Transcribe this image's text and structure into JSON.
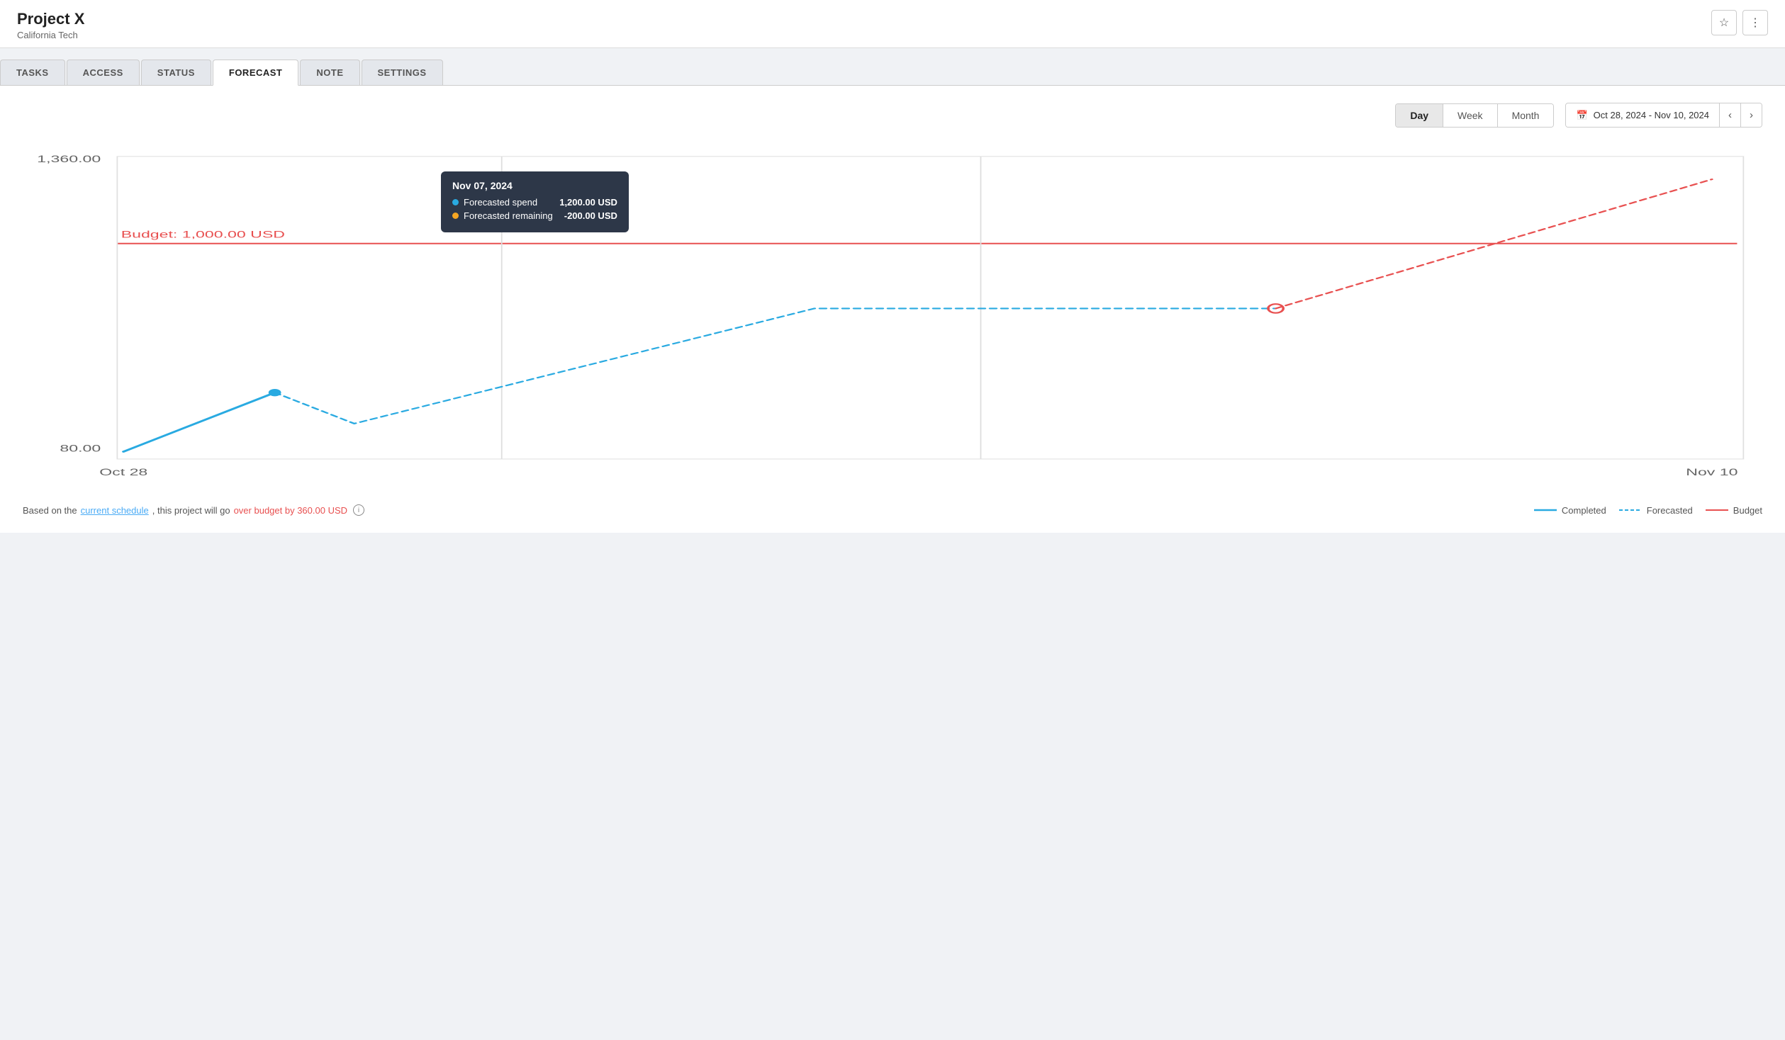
{
  "header": {
    "project_title": "Project X",
    "project_subtitle": "California Tech",
    "star_icon": "★",
    "more_icon": "⋮"
  },
  "tabs": [
    {
      "id": "tasks",
      "label": "TASKS",
      "active": false
    },
    {
      "id": "access",
      "label": "ACCESS",
      "active": false
    },
    {
      "id": "status",
      "label": "STATUS",
      "active": false
    },
    {
      "id": "forecast",
      "label": "FORECAST",
      "active": true
    },
    {
      "id": "note",
      "label": "NOTE",
      "active": false
    },
    {
      "id": "settings",
      "label": "SETTINGS",
      "active": false
    }
  ],
  "chart": {
    "view_buttons": [
      {
        "id": "day",
        "label": "Day",
        "active": true
      },
      {
        "id": "week",
        "label": "Week",
        "active": false
      },
      {
        "id": "month",
        "label": "Month",
        "active": false
      }
    ],
    "date_range": "Oct 28, 2024 - Nov 10, 2024",
    "x_start_label": "Oct 28",
    "x_end_label": "Nov 10",
    "y_top_label": "1,360.00",
    "y_bottom_label": "80.00",
    "budget_label": "Budget:",
    "budget_value": "1,000.00 USD",
    "tooltip": {
      "date": "Nov 07, 2024",
      "forecasted_spend_label": "Forecasted spend",
      "forecasted_spend_value": "1,200.00 USD",
      "forecasted_remaining_label": "Forecasted remaining",
      "forecasted_remaining_value": "-200.00 USD"
    },
    "footer": {
      "text_before_link": "Based on the",
      "link_text": "current schedule",
      "text_middle": ", this project will go",
      "over_budget_text": "over budget by 360.00 USD",
      "info_icon": "i"
    },
    "legend": [
      {
        "id": "completed",
        "label": "Completed",
        "color": "#29aae1",
        "style": "solid"
      },
      {
        "id": "forecasted",
        "label": "Forecasted",
        "color": "#29aae1",
        "style": "dashed"
      },
      {
        "id": "budget",
        "label": "Budget",
        "color": "#e85050",
        "style": "solid"
      }
    ]
  }
}
